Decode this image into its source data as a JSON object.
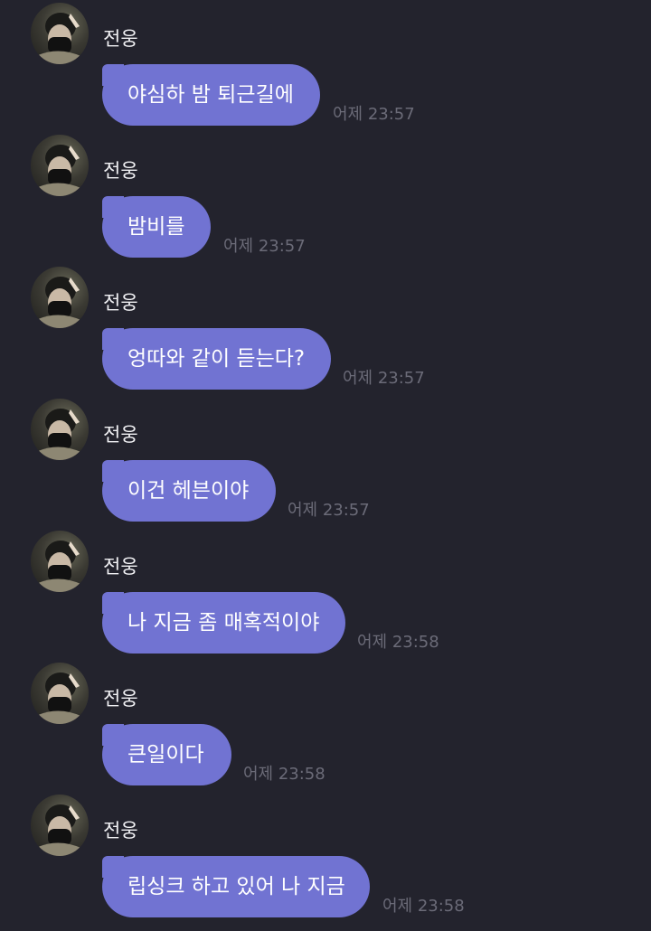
{
  "colors": {
    "background": "#23232d",
    "bubble": "#7173d2",
    "sender_text": "#f1f1f4",
    "timestamp_text": "#6b6b78"
  },
  "messages": [
    {
      "sender": "전웅",
      "text": "야심하 밤 퇴근길에",
      "time": "어제 23:57"
    },
    {
      "sender": "전웅",
      "text": "밤비를",
      "time": "어제 23:57"
    },
    {
      "sender": "전웅",
      "text": "엉따와 같이 듣는다?",
      "time": "어제 23:57"
    },
    {
      "sender": "전웅",
      "text": "이건 헤븐이야",
      "time": "어제 23:57"
    },
    {
      "sender": "전웅",
      "text": "나 지금 좀 매혹적이야",
      "time": "어제 23:58"
    },
    {
      "sender": "전웅",
      "text": "큰일이다",
      "time": "어제 23:58"
    },
    {
      "sender": "전웅",
      "text": "립싱크 하고 있어 나 지금",
      "time": "어제 23:58"
    }
  ]
}
